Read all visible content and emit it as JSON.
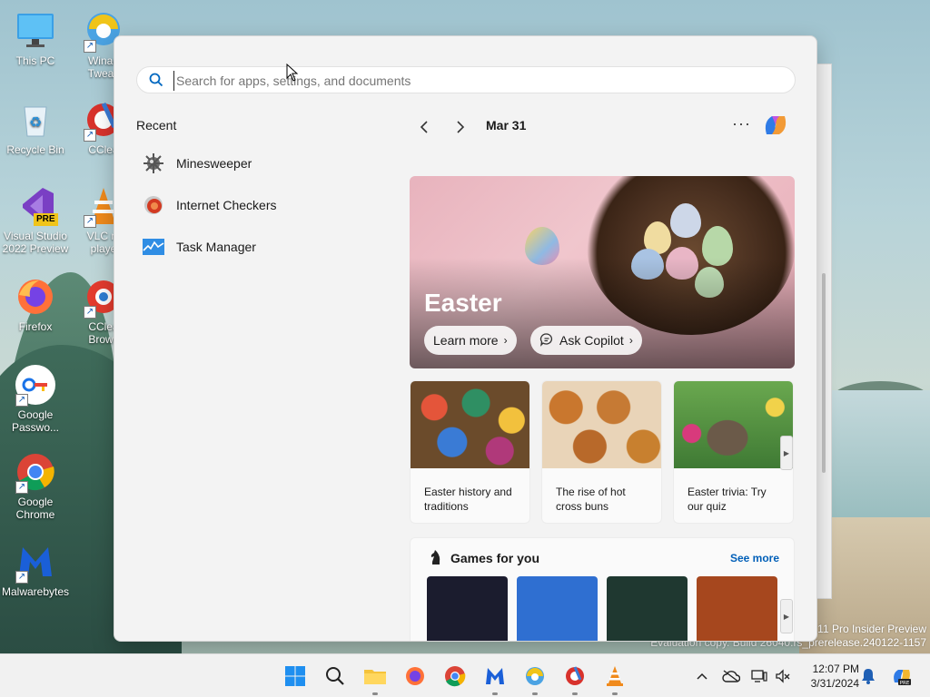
{
  "desktop": {
    "icons": [
      {
        "label": "This PC"
      },
      {
        "label": "Winaero Tweaker",
        "display": "Winae\nTweak"
      },
      {
        "label": "Recycle Bin"
      },
      {
        "label": "CCleaner",
        "display": "CClea"
      },
      {
        "label": "Visual Studio 2022 Preview",
        "display": "Visual Studio\n2022 Preview",
        "badge": "PRE"
      },
      {
        "label": "VLC media player",
        "display": "VLC m\nplaye"
      },
      {
        "label": "Firefox"
      },
      {
        "label": "CCleaner Browser",
        "display": "CClea\nBrows"
      },
      {
        "label": "Google Passwo...",
        "display": "Google\nPasswo..."
      },
      {
        "label": "Google Chrome",
        "display": "Google\nChrome"
      },
      {
        "label": "Malwarebytes"
      }
    ],
    "watermark_line1": "11 Pro Insider Preview",
    "watermark_line2": "Evaluation copy. Build 26040.rs_prerelease.240122-1157"
  },
  "start_menu": {
    "search_placeholder": "Search for apps, settings, and documents",
    "recent_title": "Recent",
    "recent_items": [
      {
        "label": "Minesweeper",
        "icon": "mine-icon"
      },
      {
        "label": "Internet Checkers",
        "icon": "checkers-icon"
      },
      {
        "label": "Task Manager",
        "icon": "task-manager-icon"
      }
    ],
    "date": "Mar 31",
    "more": "···",
    "hero": {
      "title": "Easter",
      "learn_more": "Learn more",
      "ask_copilot": "Ask Copilot"
    },
    "cards": [
      {
        "caption": "Easter history and traditions"
      },
      {
        "caption": "The rise of hot cross buns"
      },
      {
        "caption": "Easter trivia: Try our quiz"
      }
    ],
    "games": {
      "title": "Games for you",
      "see_more": "See more",
      "tile_colors": [
        "#1b1c2e",
        "#2f6fd1",
        "#1f3830",
        "#a6471e"
      ]
    }
  },
  "taskbar": {
    "time": "12:07 PM",
    "date": "3/31/2024",
    "colors": {
      "accent": "#0067c0"
    }
  }
}
